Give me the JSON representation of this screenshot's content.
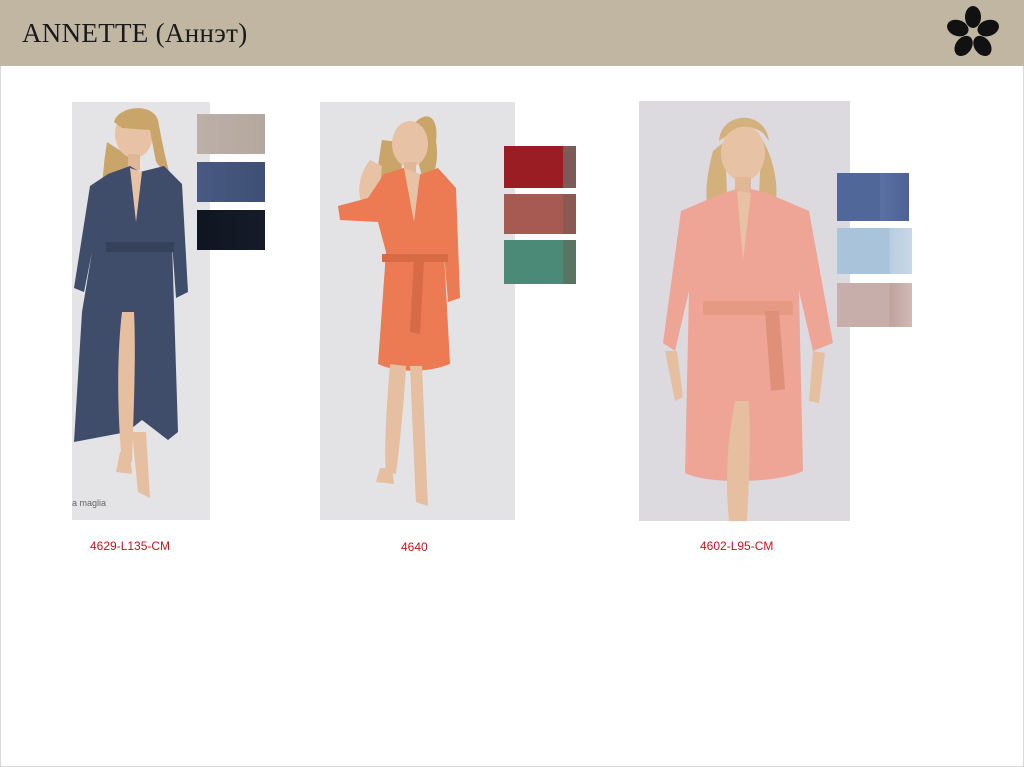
{
  "header": {
    "title": "ANNETTE (Аннэт)",
    "logo_icon": "flower-logo-icon",
    "background": "#c0b6a2"
  },
  "products": [
    {
      "code": "4629-L135-CM",
      "photo_caption": "a maglia",
      "garment_color": "#3f4d6b",
      "swatches": [
        "#b9ada4",
        "#44577d",
        "#0f1520"
      ]
    },
    {
      "code": "4640",
      "photo_caption": "",
      "garment_color": "#ec7a52",
      "swatches": [
        "#9a1d24",
        "#a65a52",
        "#4c8a78"
      ]
    },
    {
      "code": "4602-L95-CM",
      "photo_caption": "",
      "garment_color": "#eea595",
      "swatches": [
        "#50679a",
        "#a8c3da",
        "#c8aeaa"
      ]
    }
  ]
}
